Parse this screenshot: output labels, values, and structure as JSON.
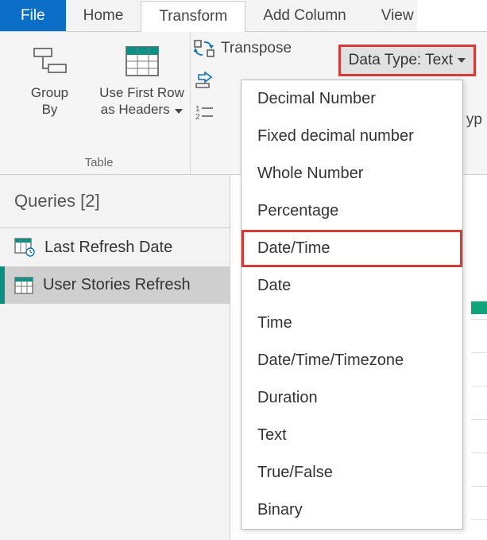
{
  "tabs": {
    "file": "File",
    "home": "Home",
    "transform": "Transform",
    "add_column": "Add Column",
    "view": "View"
  },
  "ribbon": {
    "group_table_label": "Table",
    "group_by": "Group\nBy",
    "use_first_row": "Use First Row\nas Headers",
    "transpose": "Transpose",
    "data_type_button": "Data Type: Text",
    "truncated": "yp"
  },
  "queries": {
    "header": "Queries [2]",
    "items": [
      {
        "label": "Last Refresh Date"
      },
      {
        "label": "User Stories Refresh"
      }
    ]
  },
  "dropdown": {
    "items": [
      "Decimal Number",
      "Fixed decimal number",
      "Whole Number",
      "Percentage",
      "Date/Time",
      "Date",
      "Time",
      "Date/Time/Timezone",
      "Duration",
      "Text",
      "True/False",
      "Binary"
    ],
    "highlighted_index": 4
  }
}
